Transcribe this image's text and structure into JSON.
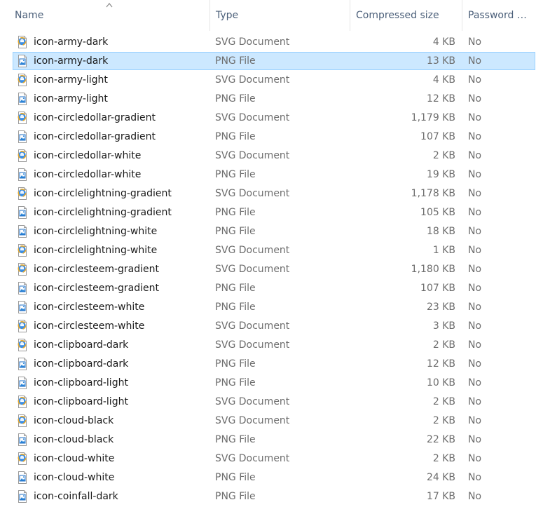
{
  "columns": {
    "name": "Name",
    "type": "Type",
    "compressed_size": "Compressed size",
    "password": "Password p..."
  },
  "files": [
    {
      "name": "icon-army-dark",
      "type": "SVG Document",
      "size": "4 KB",
      "password": "No",
      "icon": "svg-document-icon",
      "selected": false
    },
    {
      "name": "icon-army-dark",
      "type": "PNG File",
      "size": "13 KB",
      "password": "No",
      "icon": "png-file-icon",
      "selected": true
    },
    {
      "name": "icon-army-light",
      "type": "SVG Document",
      "size": "4 KB",
      "password": "No",
      "icon": "svg-document-icon",
      "selected": false
    },
    {
      "name": "icon-army-light",
      "type": "PNG File",
      "size": "12 KB",
      "password": "No",
      "icon": "png-file-icon",
      "selected": false
    },
    {
      "name": "icon-circledollar-gradient",
      "type": "SVG Document",
      "size": "1,179 KB",
      "password": "No",
      "icon": "svg-document-icon",
      "selected": false
    },
    {
      "name": "icon-circledollar-gradient",
      "type": "PNG File",
      "size": "107 KB",
      "password": "No",
      "icon": "png-file-icon",
      "selected": false
    },
    {
      "name": "icon-circledollar-white",
      "type": "SVG Document",
      "size": "2 KB",
      "password": "No",
      "icon": "svg-document-icon",
      "selected": false
    },
    {
      "name": "icon-circledollar-white",
      "type": "PNG File",
      "size": "19 KB",
      "password": "No",
      "icon": "png-file-icon",
      "selected": false
    },
    {
      "name": "icon-circlelightning-gradient",
      "type": "SVG Document",
      "size": "1,178 KB",
      "password": "No",
      "icon": "svg-document-icon",
      "selected": false
    },
    {
      "name": "icon-circlelightning-gradient",
      "type": "PNG File",
      "size": "105 KB",
      "password": "No",
      "icon": "png-file-icon",
      "selected": false
    },
    {
      "name": "icon-circlelightning-white",
      "type": "PNG File",
      "size": "18 KB",
      "password": "No",
      "icon": "png-file-icon",
      "selected": false
    },
    {
      "name": "icon-circlelightning-white",
      "type": "SVG Document",
      "size": "1 KB",
      "password": "No",
      "icon": "svg-document-icon",
      "selected": false
    },
    {
      "name": "icon-circlesteem-gradient",
      "type": "SVG Document",
      "size": "1,180 KB",
      "password": "No",
      "icon": "svg-document-icon",
      "selected": false
    },
    {
      "name": "icon-circlesteem-gradient",
      "type": "PNG File",
      "size": "107 KB",
      "password": "No",
      "icon": "png-file-icon",
      "selected": false
    },
    {
      "name": "icon-circlesteem-white",
      "type": "PNG File",
      "size": "23 KB",
      "password": "No",
      "icon": "png-file-icon",
      "selected": false
    },
    {
      "name": "icon-circlesteem-white",
      "type": "SVG Document",
      "size": "3 KB",
      "password": "No",
      "icon": "svg-document-icon",
      "selected": false
    },
    {
      "name": "icon-clipboard-dark",
      "type": "SVG Document",
      "size": "2 KB",
      "password": "No",
      "icon": "svg-document-icon",
      "selected": false
    },
    {
      "name": "icon-clipboard-dark",
      "type": "PNG File",
      "size": "12 KB",
      "password": "No",
      "icon": "png-file-icon",
      "selected": false
    },
    {
      "name": "icon-clipboard-light",
      "type": "PNG File",
      "size": "10 KB",
      "password": "No",
      "icon": "png-file-icon",
      "selected": false
    },
    {
      "name": "icon-clipboard-light",
      "type": "SVG Document",
      "size": "2 KB",
      "password": "No",
      "icon": "svg-document-icon",
      "selected": false
    },
    {
      "name": "icon-cloud-black",
      "type": "SVG Document",
      "size": "2 KB",
      "password": "No",
      "icon": "svg-document-icon",
      "selected": false
    },
    {
      "name": "icon-cloud-black",
      "type": "PNG File",
      "size": "22 KB",
      "password": "No",
      "icon": "png-file-icon",
      "selected": false
    },
    {
      "name": "icon-cloud-white",
      "type": "SVG Document",
      "size": "2 KB",
      "password": "No",
      "icon": "svg-document-icon",
      "selected": false
    },
    {
      "name": "icon-cloud-white",
      "type": "PNG File",
      "size": "24 KB",
      "password": "No",
      "icon": "png-file-icon",
      "selected": false
    },
    {
      "name": "icon-coinfall-dark",
      "type": "PNG File",
      "size": "17 KB",
      "password": "No",
      "icon": "png-file-icon",
      "selected": false
    }
  ],
  "colors": {
    "selection_fill": "#cce8ff",
    "selection_border": "#99d1ff",
    "header_text": "#4c607a",
    "secondary_text": "#6d6d6d"
  }
}
